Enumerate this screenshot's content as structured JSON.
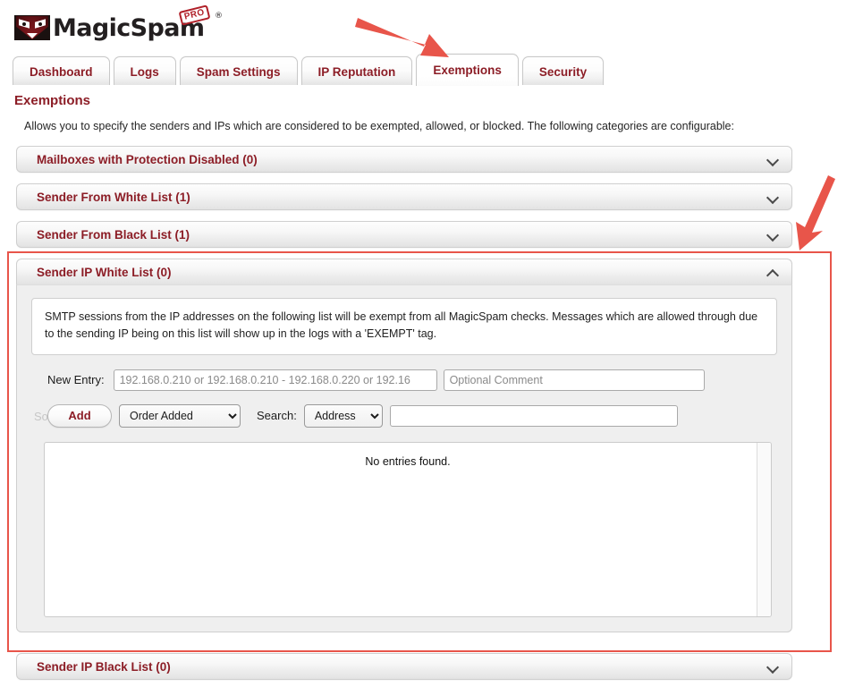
{
  "brand": {
    "name": "MagicSpam",
    "badge": "PRO",
    "registered": "®",
    "accent_color": "#8c1d26",
    "logo_icon": "angry-face-logo-icon"
  },
  "tabs": [
    {
      "label": "Dashboard",
      "active": false
    },
    {
      "label": "Logs",
      "active": false
    },
    {
      "label": "Spam Settings",
      "active": false
    },
    {
      "label": "IP Reputation",
      "active": false
    },
    {
      "label": "Exemptions",
      "active": true
    },
    {
      "label": "Security",
      "active": false
    }
  ],
  "page": {
    "title": "Exemptions",
    "description": "Allows you to specify the senders and IPs which are considered to be exempted, allowed, or blocked. The following categories are configurable:"
  },
  "panels": [
    {
      "title": "Mailboxes with Protection Disabled (0)",
      "expanded": false,
      "chevron": "chevron-down-icon"
    },
    {
      "title": "Sender From White List (1)",
      "expanded": false,
      "chevron": "chevron-down-icon"
    },
    {
      "title": "Sender From Black List (1)",
      "expanded": false,
      "chevron": "chevron-down-icon"
    },
    {
      "title": "Sender IP White List (0)",
      "expanded": true,
      "chevron": "chevron-up-icon"
    },
    {
      "title": "Sender IP Black List (0)",
      "expanded": false,
      "chevron": "chevron-down-icon"
    }
  ],
  "expanded_panel": {
    "title": "Sender IP White List (0)",
    "info_text": "SMTP sessions from the IP addresses on the following list will be exempt from all MagicSpam checks. Messages which are allowed through due to the sending IP being on this list will show up in the logs with a 'EXEMPT' tag.",
    "new_entry_label": "New Entry:",
    "new_entry_placeholder": "192.168.0.210 or 192.168.0.210 - 192.168.0.220 or 192.16",
    "new_entry_value": "",
    "comment_placeholder": "Optional Comment",
    "comment_value": "",
    "add_button": "Add",
    "sort_by_label": "Sort By:",
    "sort_selected": "Order Added",
    "search_label": "Search:",
    "search_field_selected": "Address",
    "search_value": "",
    "search_placeholder": "",
    "empty_message": "No entries found."
  },
  "annotations": {
    "arrow_color": "#e8554a",
    "highlight_color": "#e8554a",
    "arrow_top_target": "exemptions-tab",
    "arrow_right_target": "sender-ip-white-list-panel"
  }
}
